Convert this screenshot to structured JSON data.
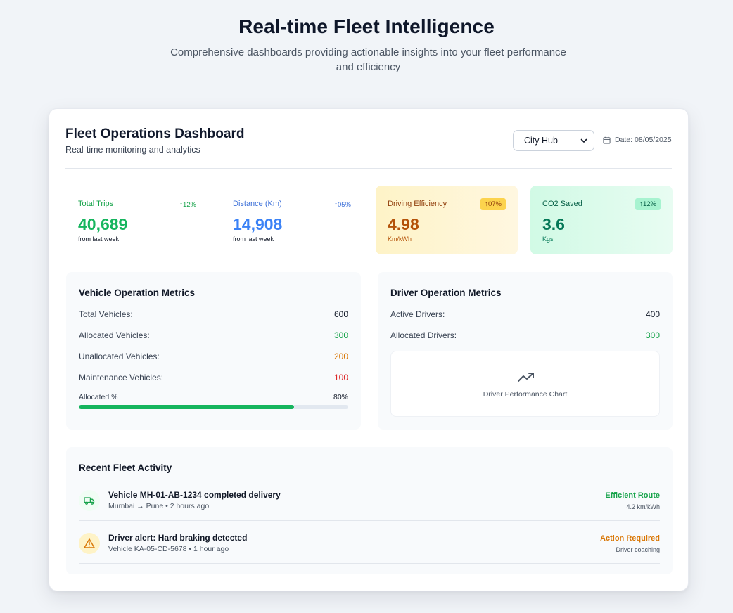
{
  "hero": {
    "title": "Real-time Fleet Intelligence",
    "subtitle": "Comprehensive dashboards providing actionable insights into your fleet performance and efficiency"
  },
  "dashboard": {
    "title": "Fleet Operations Dashboard",
    "subtitle": "Real-time monitoring and analytics",
    "hub_select": {
      "selected": "City Hub"
    },
    "date_label": "Date: 08/05/2025"
  },
  "stats": [
    {
      "label": "Total Trips",
      "change": "↑12%",
      "value": "40,689",
      "footnote": "from last week"
    },
    {
      "label": "Distance (Km)",
      "change": "↑05%",
      "value": "14,908",
      "footnote": "from last week"
    },
    {
      "label": "Driving Efficiency",
      "change": "↑07%",
      "value": "4.98",
      "footnote": "Km/kWh"
    },
    {
      "label": "CO2 Saved",
      "change": "↑12%",
      "value": "3.6",
      "footnote": "Kgs"
    }
  ],
  "vehicle_metrics": {
    "title": "Vehicle Operation Metrics",
    "rows": [
      {
        "label": "Total Vehicles:",
        "value": "600"
      },
      {
        "label": "Allocated Vehicles:",
        "value": "300"
      },
      {
        "label": "Unallocated Vehicles:",
        "value": "200"
      },
      {
        "label": "Maintenance Vehicles:",
        "value": "100"
      }
    ],
    "allocated_label": "Allocated %",
    "allocated_pct_text": "80%",
    "allocated_fraction": 0.8
  },
  "driver_metrics": {
    "title": "Driver Operation Metrics",
    "rows": [
      {
        "label": "Active Drivers:",
        "value": "400"
      },
      {
        "label": "Allocated Drivers:",
        "value": "300"
      }
    ],
    "chart_caption": "Driver Performance Chart"
  },
  "activity": {
    "title": "Recent Fleet Activity",
    "items": [
      {
        "title": "Vehicle MH-01-AB-1234 completed delivery",
        "meta": "Mumbai → Pune • 2 hours ago",
        "status": "Efficient Route",
        "detail": "4.2 km/kWh",
        "icon": "truck-icon",
        "status_color": "#16a34a"
      },
      {
        "title": "Driver alert: Hard braking detected",
        "meta": "Vehicle KA-05-CD-5678 • 1 hour ago",
        "status": "Action Required",
        "detail": "Driver coaching",
        "icon": "warning-icon",
        "status_color": "#d97706"
      }
    ]
  }
}
